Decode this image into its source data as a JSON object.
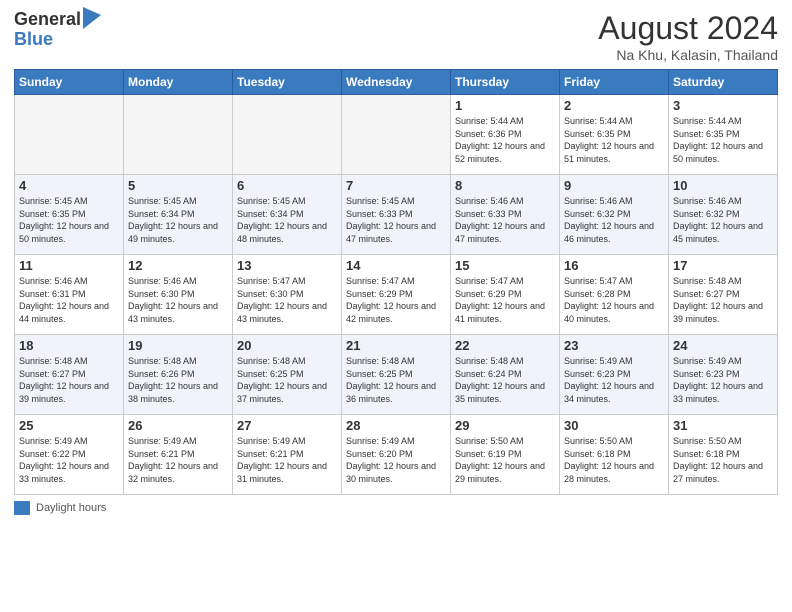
{
  "logo": {
    "general": "General",
    "blue": "Blue"
  },
  "title": "August 2024",
  "location": "Na Khu, Kalasin, Thailand",
  "days_of_week": [
    "Sunday",
    "Monday",
    "Tuesday",
    "Wednesday",
    "Thursday",
    "Friday",
    "Saturday"
  ],
  "footer_label": "Daylight hours",
  "weeks": [
    [
      {
        "day": "",
        "sunrise": "",
        "sunset": "",
        "daylight": ""
      },
      {
        "day": "",
        "sunrise": "",
        "sunset": "",
        "daylight": ""
      },
      {
        "day": "",
        "sunrise": "",
        "sunset": "",
        "daylight": ""
      },
      {
        "day": "",
        "sunrise": "",
        "sunset": "",
        "daylight": ""
      },
      {
        "day": "1",
        "sunrise": "Sunrise: 5:44 AM",
        "sunset": "Sunset: 6:36 PM",
        "daylight": "Daylight: 12 hours and 52 minutes."
      },
      {
        "day": "2",
        "sunrise": "Sunrise: 5:44 AM",
        "sunset": "Sunset: 6:35 PM",
        "daylight": "Daylight: 12 hours and 51 minutes."
      },
      {
        "day": "3",
        "sunrise": "Sunrise: 5:44 AM",
        "sunset": "Sunset: 6:35 PM",
        "daylight": "Daylight: 12 hours and 50 minutes."
      }
    ],
    [
      {
        "day": "4",
        "sunrise": "Sunrise: 5:45 AM",
        "sunset": "Sunset: 6:35 PM",
        "daylight": "Daylight: 12 hours and 50 minutes."
      },
      {
        "day": "5",
        "sunrise": "Sunrise: 5:45 AM",
        "sunset": "Sunset: 6:34 PM",
        "daylight": "Daylight: 12 hours and 49 minutes."
      },
      {
        "day": "6",
        "sunrise": "Sunrise: 5:45 AM",
        "sunset": "Sunset: 6:34 PM",
        "daylight": "Daylight: 12 hours and 48 minutes."
      },
      {
        "day": "7",
        "sunrise": "Sunrise: 5:45 AM",
        "sunset": "Sunset: 6:33 PM",
        "daylight": "Daylight: 12 hours and 47 minutes."
      },
      {
        "day": "8",
        "sunrise": "Sunrise: 5:46 AM",
        "sunset": "Sunset: 6:33 PM",
        "daylight": "Daylight: 12 hours and 47 minutes."
      },
      {
        "day": "9",
        "sunrise": "Sunrise: 5:46 AM",
        "sunset": "Sunset: 6:32 PM",
        "daylight": "Daylight: 12 hours and 46 minutes."
      },
      {
        "day": "10",
        "sunrise": "Sunrise: 5:46 AM",
        "sunset": "Sunset: 6:32 PM",
        "daylight": "Daylight: 12 hours and 45 minutes."
      }
    ],
    [
      {
        "day": "11",
        "sunrise": "Sunrise: 5:46 AM",
        "sunset": "Sunset: 6:31 PM",
        "daylight": "Daylight: 12 hours and 44 minutes."
      },
      {
        "day": "12",
        "sunrise": "Sunrise: 5:46 AM",
        "sunset": "Sunset: 6:30 PM",
        "daylight": "Daylight: 12 hours and 43 minutes."
      },
      {
        "day": "13",
        "sunrise": "Sunrise: 5:47 AM",
        "sunset": "Sunset: 6:30 PM",
        "daylight": "Daylight: 12 hours and 43 minutes."
      },
      {
        "day": "14",
        "sunrise": "Sunrise: 5:47 AM",
        "sunset": "Sunset: 6:29 PM",
        "daylight": "Daylight: 12 hours and 42 minutes."
      },
      {
        "day": "15",
        "sunrise": "Sunrise: 5:47 AM",
        "sunset": "Sunset: 6:29 PM",
        "daylight": "Daylight: 12 hours and 41 minutes."
      },
      {
        "day": "16",
        "sunrise": "Sunrise: 5:47 AM",
        "sunset": "Sunset: 6:28 PM",
        "daylight": "Daylight: 12 hours and 40 minutes."
      },
      {
        "day": "17",
        "sunrise": "Sunrise: 5:48 AM",
        "sunset": "Sunset: 6:27 PM",
        "daylight": "Daylight: 12 hours and 39 minutes."
      }
    ],
    [
      {
        "day": "18",
        "sunrise": "Sunrise: 5:48 AM",
        "sunset": "Sunset: 6:27 PM",
        "daylight": "Daylight: 12 hours and 39 minutes."
      },
      {
        "day": "19",
        "sunrise": "Sunrise: 5:48 AM",
        "sunset": "Sunset: 6:26 PM",
        "daylight": "Daylight: 12 hours and 38 minutes."
      },
      {
        "day": "20",
        "sunrise": "Sunrise: 5:48 AM",
        "sunset": "Sunset: 6:25 PM",
        "daylight": "Daylight: 12 hours and 37 minutes."
      },
      {
        "day": "21",
        "sunrise": "Sunrise: 5:48 AM",
        "sunset": "Sunset: 6:25 PM",
        "daylight": "Daylight: 12 hours and 36 minutes."
      },
      {
        "day": "22",
        "sunrise": "Sunrise: 5:48 AM",
        "sunset": "Sunset: 6:24 PM",
        "daylight": "Daylight: 12 hours and 35 minutes."
      },
      {
        "day": "23",
        "sunrise": "Sunrise: 5:49 AM",
        "sunset": "Sunset: 6:23 PM",
        "daylight": "Daylight: 12 hours and 34 minutes."
      },
      {
        "day": "24",
        "sunrise": "Sunrise: 5:49 AM",
        "sunset": "Sunset: 6:23 PM",
        "daylight": "Daylight: 12 hours and 33 minutes."
      }
    ],
    [
      {
        "day": "25",
        "sunrise": "Sunrise: 5:49 AM",
        "sunset": "Sunset: 6:22 PM",
        "daylight": "Daylight: 12 hours and 33 minutes."
      },
      {
        "day": "26",
        "sunrise": "Sunrise: 5:49 AM",
        "sunset": "Sunset: 6:21 PM",
        "daylight": "Daylight: 12 hours and 32 minutes."
      },
      {
        "day": "27",
        "sunrise": "Sunrise: 5:49 AM",
        "sunset": "Sunset: 6:21 PM",
        "daylight": "Daylight: 12 hours and 31 minutes."
      },
      {
        "day": "28",
        "sunrise": "Sunrise: 5:49 AM",
        "sunset": "Sunset: 6:20 PM",
        "daylight": "Daylight: 12 hours and 30 minutes."
      },
      {
        "day": "29",
        "sunrise": "Sunrise: 5:50 AM",
        "sunset": "Sunset: 6:19 PM",
        "daylight": "Daylight: 12 hours and 29 minutes."
      },
      {
        "day": "30",
        "sunrise": "Sunrise: 5:50 AM",
        "sunset": "Sunset: 6:18 PM",
        "daylight": "Daylight: 12 hours and 28 minutes."
      },
      {
        "day": "31",
        "sunrise": "Sunrise: 5:50 AM",
        "sunset": "Sunset: 6:18 PM",
        "daylight": "Daylight: 12 hours and 27 minutes."
      }
    ]
  ]
}
